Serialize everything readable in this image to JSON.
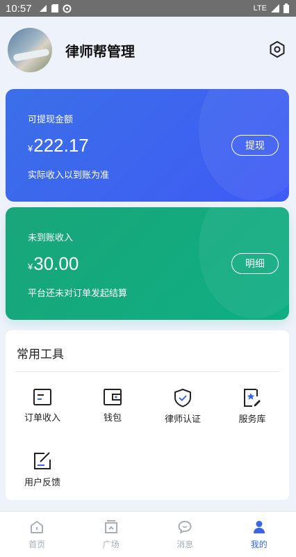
{
  "status_bar": {
    "time": "10:57",
    "network": "LTE"
  },
  "header": {
    "title": "律师帮管理"
  },
  "cards": [
    {
      "label": "可提现金额",
      "currency": "¥",
      "amount": "222.17",
      "note": "实际收入以到账为准",
      "button": "提现"
    },
    {
      "label": "未到账收入",
      "currency": "¥",
      "amount": "30.00",
      "note": "平台还未对订单发起结算",
      "button": "明细"
    }
  ],
  "tools": {
    "heading": "常用工具",
    "items": [
      {
        "label": "订单收入",
        "icon": "order-income-icon"
      },
      {
        "label": "钱包",
        "icon": "wallet-icon"
      },
      {
        "label": "律师认证",
        "icon": "certification-shield-icon"
      },
      {
        "label": "服务库",
        "icon": "service-library-icon"
      },
      {
        "label": "用户反馈",
        "icon": "feedback-icon"
      }
    ]
  },
  "tabbar": {
    "items": [
      {
        "label": "首页",
        "icon": "home-icon",
        "active": false
      },
      {
        "label": "广场",
        "icon": "square-icon",
        "active": false
      },
      {
        "label": "消息",
        "icon": "message-icon",
        "active": false
      },
      {
        "label": "我的",
        "icon": "profile-icon",
        "active": true
      }
    ]
  },
  "colors": {
    "accent": "#3a64e9",
    "blue_card": "#3f5bf5",
    "green_card": "#15a97e",
    "inactive_tab": "#a9adb5"
  }
}
